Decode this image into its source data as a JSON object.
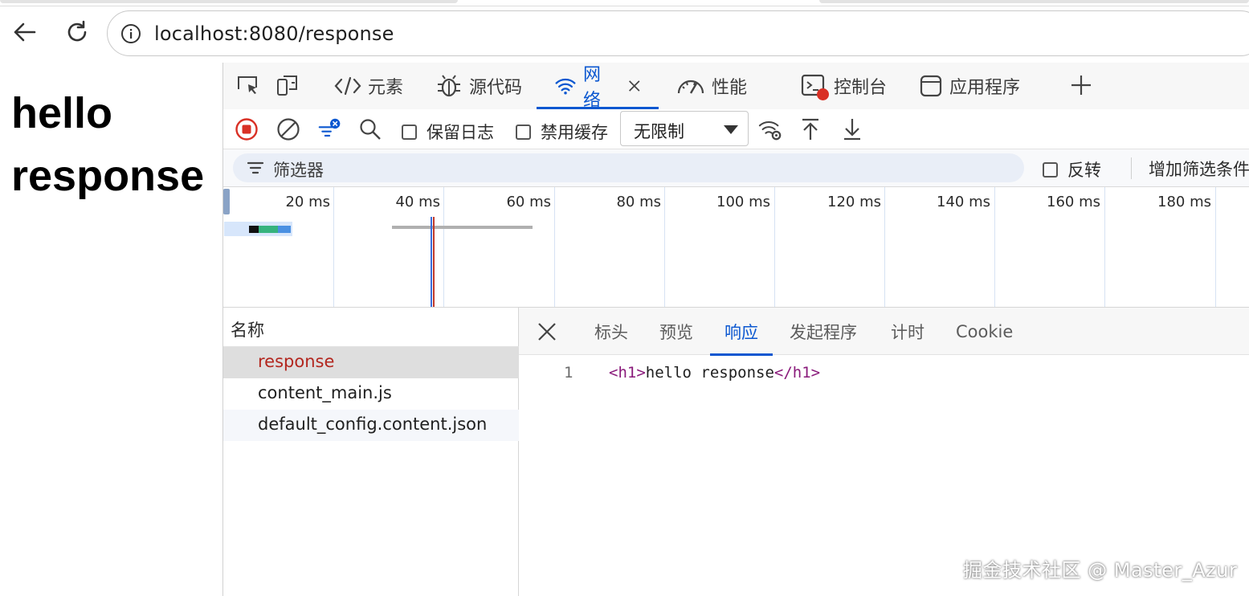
{
  "browser": {
    "url": "localhost:8080/response",
    "back_icon": "arrow-left-icon",
    "reload_icon": "reload-icon",
    "info_icon": "info-circle-icon"
  },
  "page": {
    "heading": "hello response"
  },
  "devtools": {
    "tabs": [
      {
        "label": "元素",
        "icon": "code-brackets-icon"
      },
      {
        "label": "源代码",
        "icon": "bug-icon"
      },
      {
        "label": "网络",
        "icon": "wifi-icon",
        "active": true
      },
      {
        "label": "性能",
        "icon": "gauge-icon"
      },
      {
        "label": "控制台",
        "icon": "console-icon"
      },
      {
        "label": "应用程序",
        "icon": "app-window-icon"
      }
    ],
    "toolbar": {
      "preserve_log": "保留日志",
      "disable_cache": "禁用缓存",
      "throttling": "无限制"
    },
    "filter": {
      "placeholder": "筛选器",
      "invert": "反转",
      "more_filters": "增加筛选条件"
    },
    "overview": {
      "ticks": [
        "20 ms",
        "40 ms",
        "60 ms",
        "80 ms",
        "100 ms",
        "120 ms",
        "140 ms",
        "160 ms",
        "180 ms"
      ]
    },
    "requests": {
      "column": "名称",
      "rows": [
        "response",
        "content_main.js",
        "default_config.content.json"
      ]
    },
    "detail": {
      "tabs": [
        "标头",
        "预览",
        "响应",
        "发起程序",
        "计时",
        "Cookie"
      ],
      "active_tab": "响应",
      "line_number": "1",
      "code_open_tag": "<h1>",
      "code_text": "hello response",
      "code_close_tag": "</h1>"
    }
  },
  "watermark": "掘金技术社区 @ Master_Azur",
  "colors": {
    "accent": "#0b57d0",
    "selected_request": "#b3261e",
    "record": "#d93025"
  }
}
